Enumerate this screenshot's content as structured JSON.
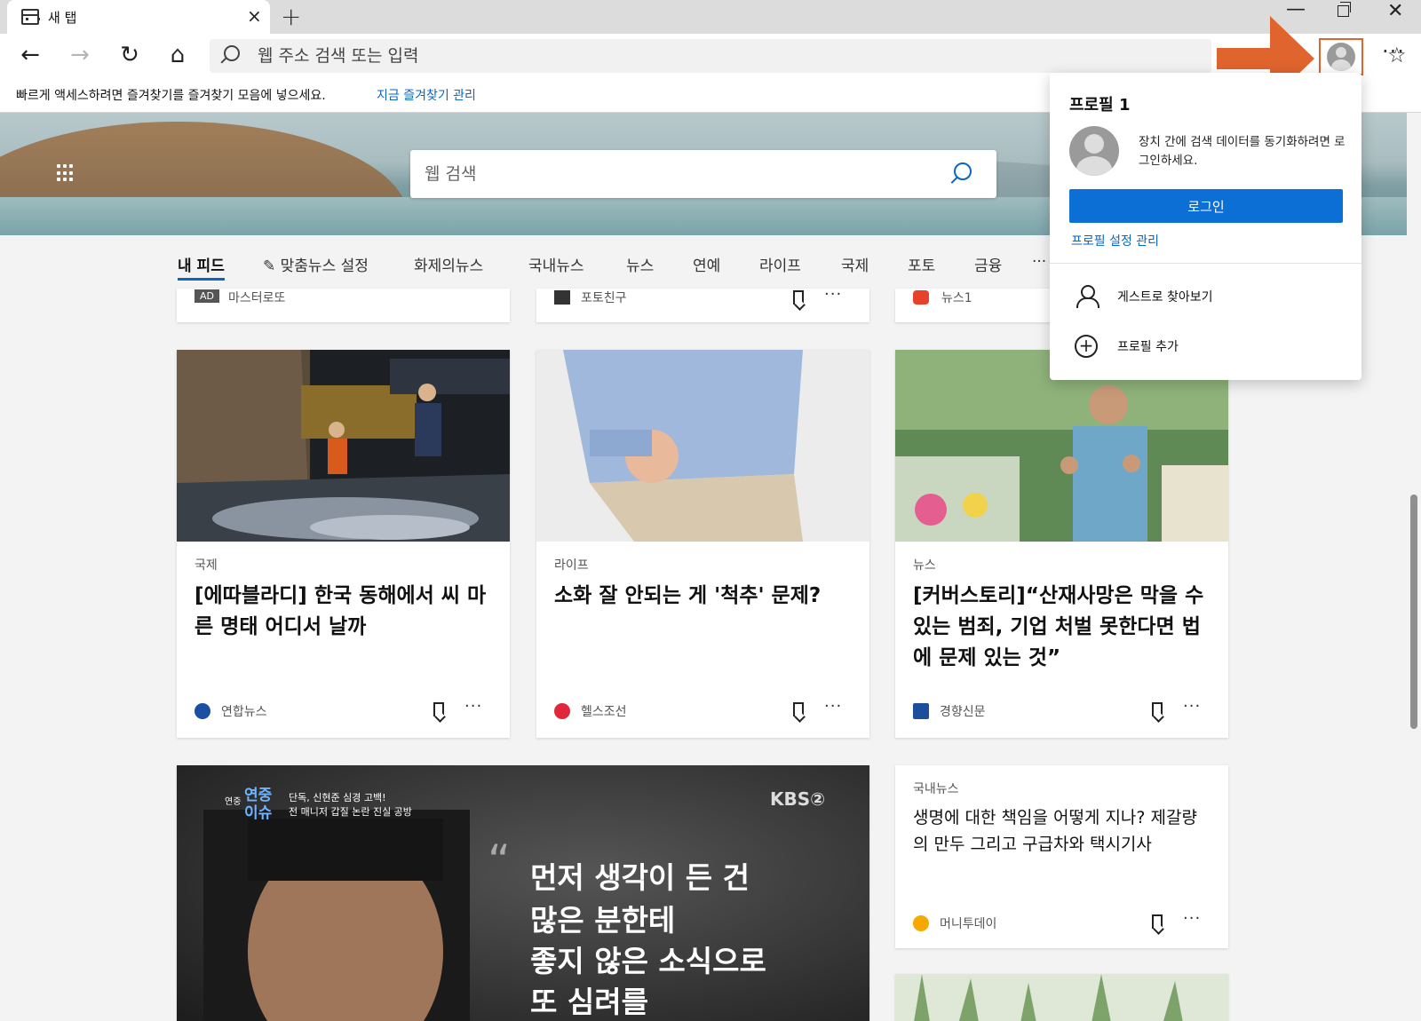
{
  "tab": {
    "title": "새 탭",
    "close_glyph": "×",
    "new_tab_glyph": "+"
  },
  "window": {
    "minimize_glyph": "—",
    "close_glyph": "✕"
  },
  "toolbar": {
    "back_glyph": "←",
    "forward_glyph": "→",
    "refresh_glyph": "↻",
    "home_glyph": "⌂",
    "address_placeholder": "웹 주소 검색 또는 입력",
    "favorite_glyph": "☆",
    "more_glyph": "···"
  },
  "favbar": {
    "message": "빠르게 액세스하려면 즐겨찾기를 즐겨찾기 모음에 넣으세요.",
    "link": "지금 즐겨찾기 관리"
  },
  "hero": {
    "search_placeholder": "웹 검색"
  },
  "feed_nav": {
    "items": [
      "내 피드",
      "맞춤뉴스 설정",
      "화제의뉴스",
      "국내뉴스",
      "뉴스",
      "연예",
      "라이프",
      "국제",
      "포토",
      "금융",
      "···"
    ],
    "edit_glyph": "✎"
  },
  "top_row": [
    {
      "badge": "AD",
      "source": "마스터로또"
    },
    {
      "source": "포토친구"
    },
    {
      "source": "뉴스1"
    }
  ],
  "cards": [
    {
      "category": "국제",
      "title": "[에따블라디] 한국 동해에서 씨 마른 명태 어디서 날까",
      "source": "연합뉴스"
    },
    {
      "category": "라이프",
      "title": "소화 잘 안되는 게 '척추' 문제?",
      "source": "헬스조선"
    },
    {
      "category": "뉴스",
      "title": "[커버스토리]“산재사망은 막을 수 있는 범죄, 기업 처벌 못한다면 법에 문제 있는 것”",
      "source": "경향신문"
    },
    {
      "category": "국내뉴스",
      "title": "생명에 대한 책임을 어떻게 지나? 제갈량의 만두 그리고 구급차와 택시기사",
      "source": "머니투데이"
    }
  ],
  "big_card": {
    "corner_logo": "KBS②",
    "tag_small": "연중",
    "tag_big": "연중 이슈",
    "headline_line1": "단독, 신현준 심경 고백!",
    "headline_line2": "전 매니저 갑질 논란 진실 공방",
    "quote_mark": "“",
    "quote_lines": [
      "먼저 생각이 든 건",
      "많은 분한테",
      "좋지 않은 소식으로",
      "또 심려를"
    ]
  },
  "card_more_glyph": "···",
  "profile_flyout": {
    "title": "프로필 1",
    "message": "장치 간에 검색 데이터를 동기화하려면 로그인하세요.",
    "login_button": "로그인",
    "manage_link": "프로필 설정 관리",
    "guest_label": "게스트로 찾아보기",
    "add_label": "프로필 추가"
  },
  "colors": {
    "accent": "#0a66c2",
    "login_button": "#0b6fd6",
    "highlight": "#e0642e"
  },
  "icons": [
    "tab-page-icon",
    "back-arrow-icon",
    "forward-arrow-icon",
    "refresh-icon",
    "home-icon",
    "search-icon",
    "star-icon",
    "profile-avatar-icon",
    "more-icon",
    "waffle-icon",
    "bookmark-icon",
    "guest-icon",
    "plus-icon"
  ]
}
